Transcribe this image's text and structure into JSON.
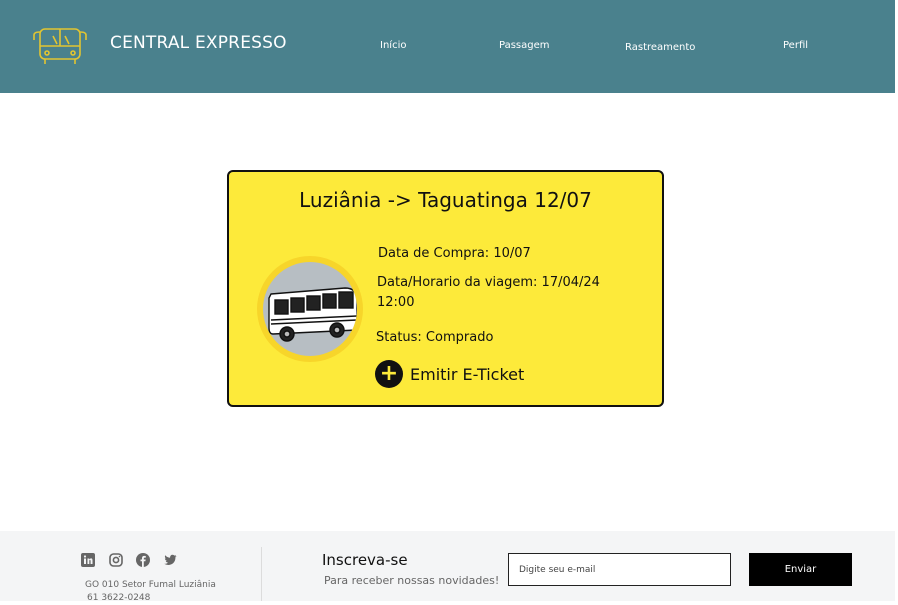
{
  "header": {
    "brand": "CENTRAL EXPRESSO",
    "logo_icon": "bus-icon",
    "nav": [
      "Início",
      "Passagem",
      "Rastreamento",
      "Perfil"
    ],
    "background": "#4a818d"
  },
  "ticket": {
    "route": "Luziânia -> Taguatinga 12/07",
    "purchase_date": "Data de Compra: 10/07",
    "travel_datetime_line1": "Data/Horario da viagem: 17/04/24",
    "travel_datetime_line2": "12:00",
    "status": "Status: Comprado",
    "action_label": "Emitir E-Ticket",
    "action_icon": "plus-circle-icon",
    "image_icon": "bus-icon",
    "background": "#fdea3a"
  },
  "footer": {
    "social_icons": [
      "linkedin-icon",
      "instagram-icon",
      "facebook-icon",
      "twitter-icon"
    ],
    "address_line1": "GO 010 Setor Fumal Luziânia",
    "address_line2": "61 3622-0248",
    "subscribe_title": "Inscreva-se",
    "subscribe_text": "Para receber nossas novidades!",
    "email_placeholder": "Digite seu e-mail",
    "send_label": "Enviar"
  }
}
